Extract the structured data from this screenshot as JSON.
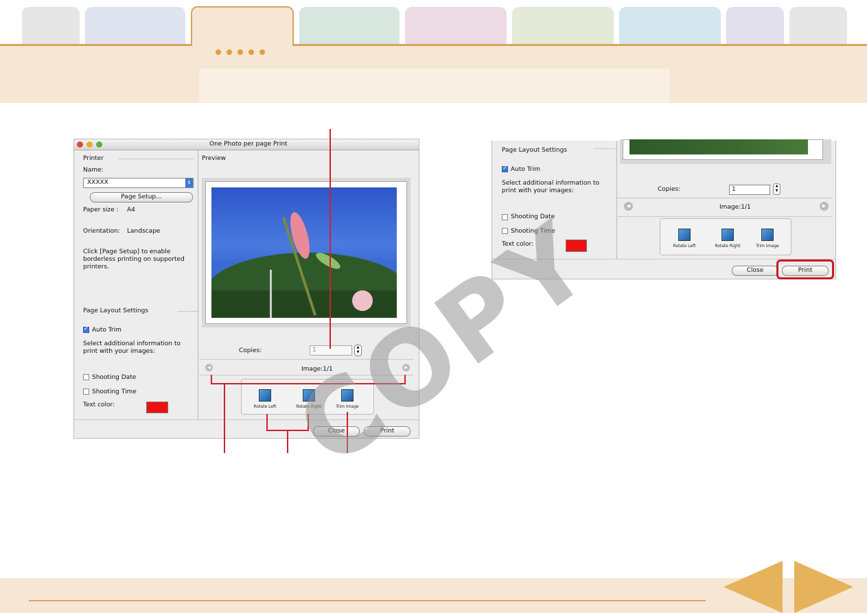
{
  "dialog": {
    "title": "One Photo per page Print",
    "printer_section": "Printer",
    "name_label": "Name:",
    "printer_name": "XXXXX",
    "page_setup_button": "Page Setup...",
    "paper_size_label": "Paper size :",
    "paper_size_value": "A4",
    "orientation_label": "Orientation:",
    "orientation_value": "Landscape",
    "borderless_note": "Click [Page Setup] to enable borderless printing on supported printers.",
    "layout_section": "Page Layout Settings",
    "auto_trim": "Auto Trim",
    "additional_info": "Select additional information to print with your images:",
    "shooting_date": "Shooting Date",
    "shooting_time": "Shooting Time",
    "text_color_label": "Text color:",
    "text_color": "#ee1111",
    "preview_label": "Preview",
    "copies_label": "Copies:",
    "copies_value": "1",
    "image_counter": "Image:1/1",
    "tools": [
      "Rotate Left",
      "Rotate Right",
      "Trim Image"
    ],
    "close_button": "Close",
    "print_button": "Print"
  },
  "detail": {
    "layout_section": "Page Layout Settings",
    "auto_trim": "Auto Trim",
    "additional_info": "Select additional information to print with your images:",
    "shooting_date": "Shooting Date",
    "shooting_time": "Shooting Time",
    "text_color_label": "Text color:",
    "copies_label": "Copies:",
    "copies_value": "1",
    "image_counter": "Image:1/1",
    "tools": [
      "Rotate Left",
      "Rotate Right",
      "Trim Image"
    ],
    "close_button": "Close",
    "print_button": "Print"
  },
  "watermark": "COPY",
  "colors": {
    "accent": "#d9a35a",
    "callout": "#d0202a",
    "highlight": "#cc1a24"
  }
}
